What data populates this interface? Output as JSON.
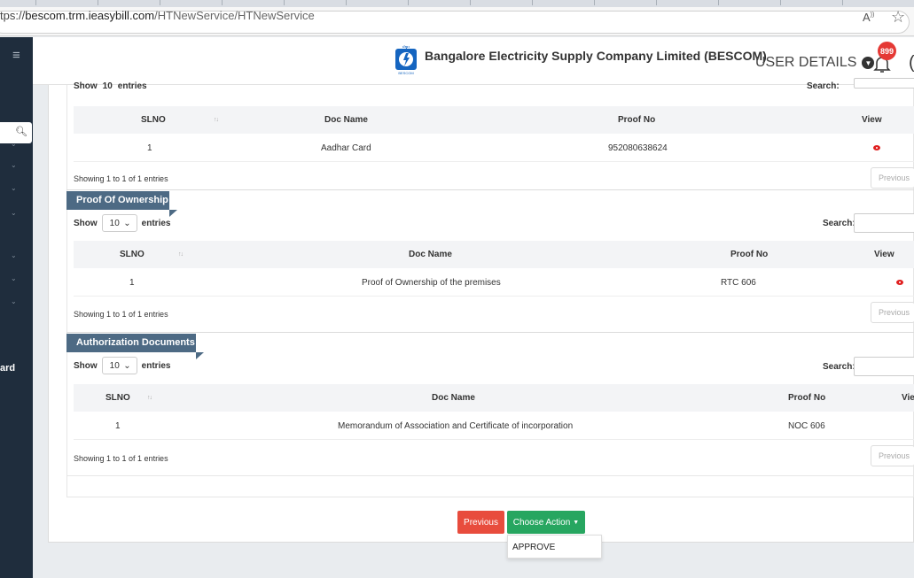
{
  "browser": {
    "url_scheme": "tps://",
    "url_host": "bescom.trm.ieasybill.com",
    "url_path": "/HTNewService/HTNewService",
    "read_aloud_icon": "read-aloud-icon",
    "favorite_icon": "star-icon"
  },
  "header": {
    "company_name": "Bangalore Electricity Supply Company Limited (BESCOM)",
    "user_details_label": "USER DETAILS",
    "notification_count": "899",
    "logo_text": "BESCOM"
  },
  "sidebar": {
    "label_fragment": "ard"
  },
  "top_section": {
    "show_label": "Show",
    "entries_label": "entries",
    "show_value": "10",
    "search_label": "Search:",
    "columns": [
      "SLNO",
      "Doc Name",
      "Proof No",
      "View"
    ],
    "rows": [
      {
        "slno": "1",
        "doc_name": "Aadhar Card",
        "proof_no": "952080638624"
      }
    ],
    "showing_text": "Showing 1 to 1 of 1 entries",
    "previous_label": "Previous"
  },
  "ownership_section": {
    "title": "Proof Of Ownership",
    "show_label": "Show",
    "show_value": "10",
    "entries_label": "entries",
    "search_label": "Search:",
    "columns": [
      "SLNO",
      "Doc Name",
      "Proof No",
      "View"
    ],
    "rows": [
      {
        "slno": "1",
        "doc_name": "Proof of Ownership of the premises",
        "proof_no": "RTC 606"
      }
    ],
    "showing_text": "Showing 1 to 1 of 1 entries",
    "previous_label": "Previous"
  },
  "authorization_section": {
    "title": "Authorization Documents",
    "show_label": "Show",
    "show_value": "10",
    "entries_label": "entries",
    "search_label": "Search:",
    "columns": [
      "SLNO",
      "Doc Name",
      "Proof No",
      "Vie"
    ],
    "rows": [
      {
        "slno": "1",
        "doc_name": "Memorandum of Association and Certificate of incorporation",
        "proof_no": "NOC 606"
      }
    ],
    "showing_text": "Showing 1 to 1 of 1 entries",
    "previous_label": "Previous"
  },
  "actions": {
    "previous_label": "Previous",
    "choose_action_label": "Choose Action",
    "dropdown_items": [
      "APPROVE"
    ]
  },
  "colors": {
    "sidebar_bg": "#1f2d3d",
    "section_tag": "#4d6a84",
    "previous_button": "#e84c3d",
    "choose_action_button": "#27a660",
    "view_icon": "#e02020"
  }
}
